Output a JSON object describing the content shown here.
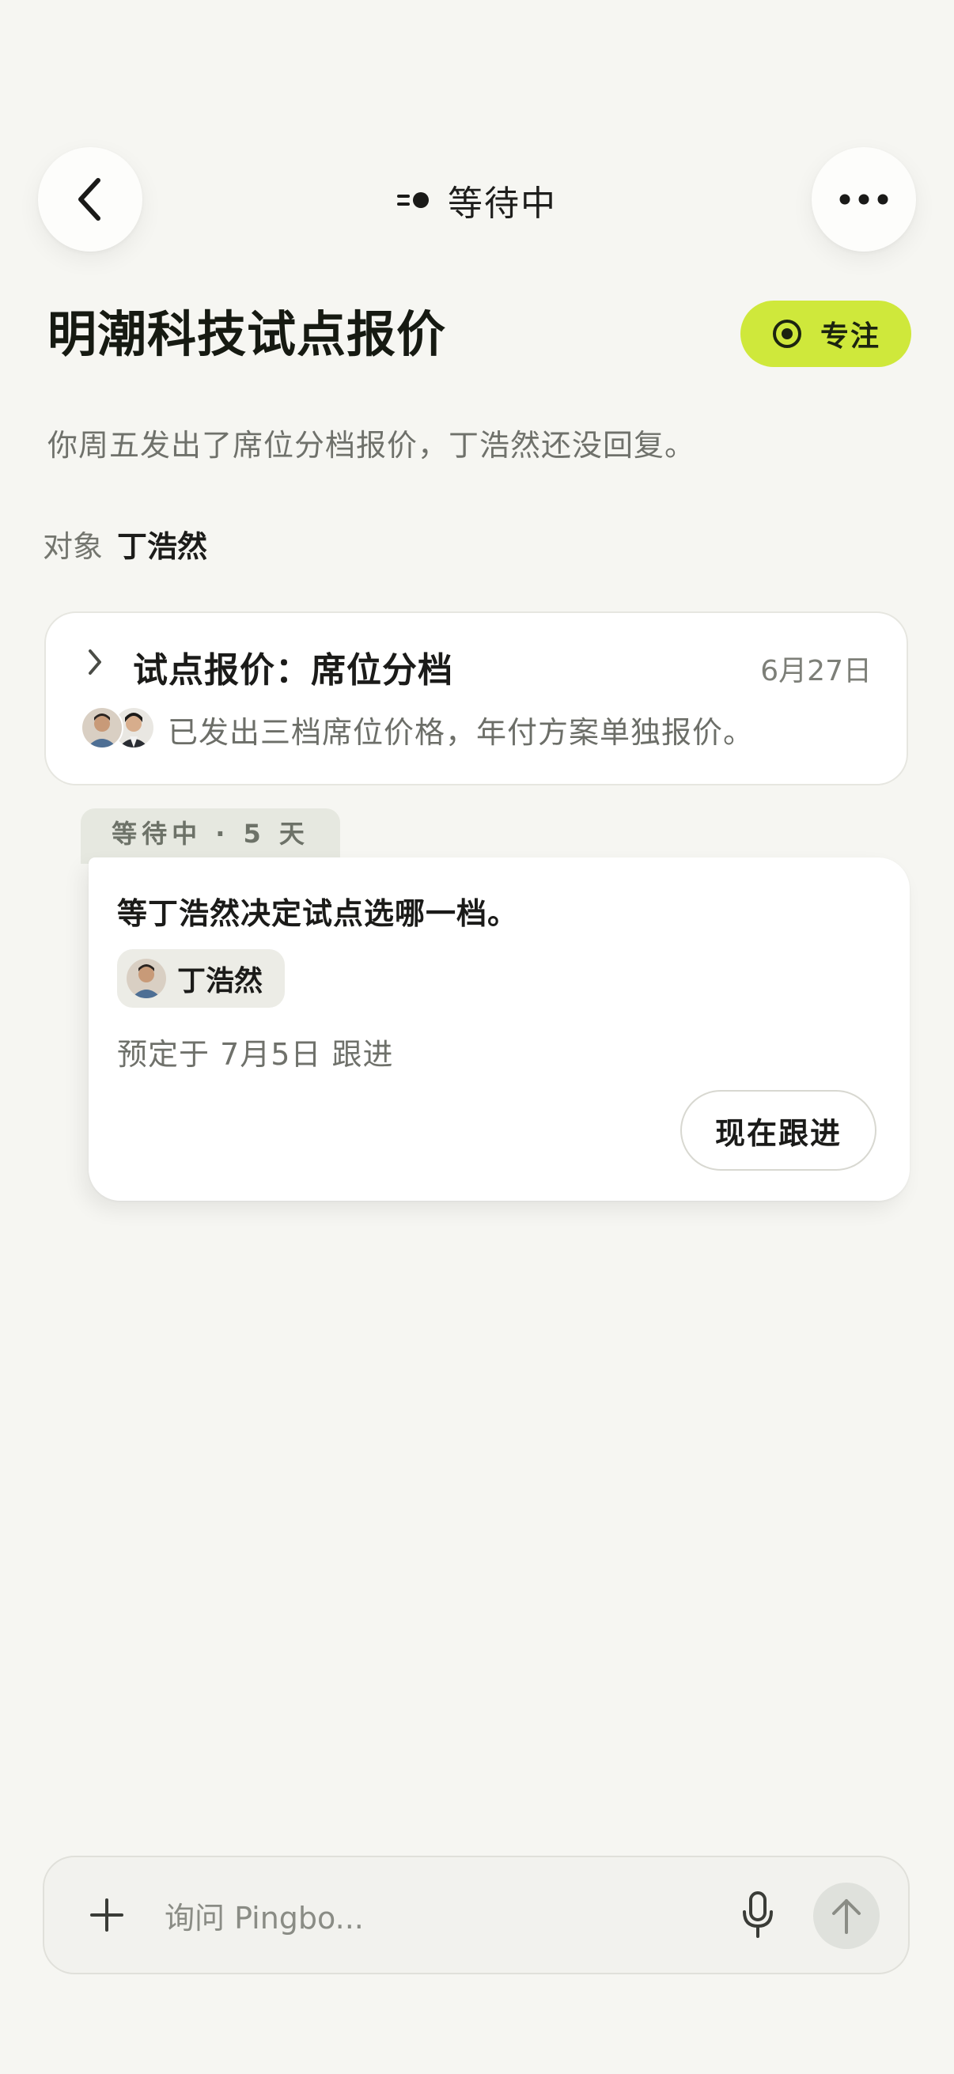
{
  "nav": {
    "status_label": "等待中",
    "back_icon": "chevron-left-icon",
    "more_icon": "more-horizontal-icon",
    "status_icon": "moving-dot-icon"
  },
  "header": {
    "title": "明潮科技试点报价",
    "focus_label": "专注",
    "focus_color": "#cfe83b",
    "subtitle": "你周五发出了席位分档报价，丁浩然还没回复。",
    "target_key": "对象",
    "target_value": "丁浩然"
  },
  "thread": {
    "title": "试点报价：席位分档",
    "date": "6月27日",
    "summary": "已发出三档席位价格，年付方案单独报价。"
  },
  "waiting": {
    "tab_label": "等待中 · 5 天",
    "text": "等丁浩然决定试点选哪一档。",
    "person": "丁浩然",
    "schedule": "预定于 7月5日 跟进",
    "action_label": "现在跟进"
  },
  "composer": {
    "placeholder": "询问 Pingbo...",
    "plus_icon": "plus-icon",
    "mic_icon": "microphone-icon",
    "send_icon": "arrow-up-icon"
  }
}
